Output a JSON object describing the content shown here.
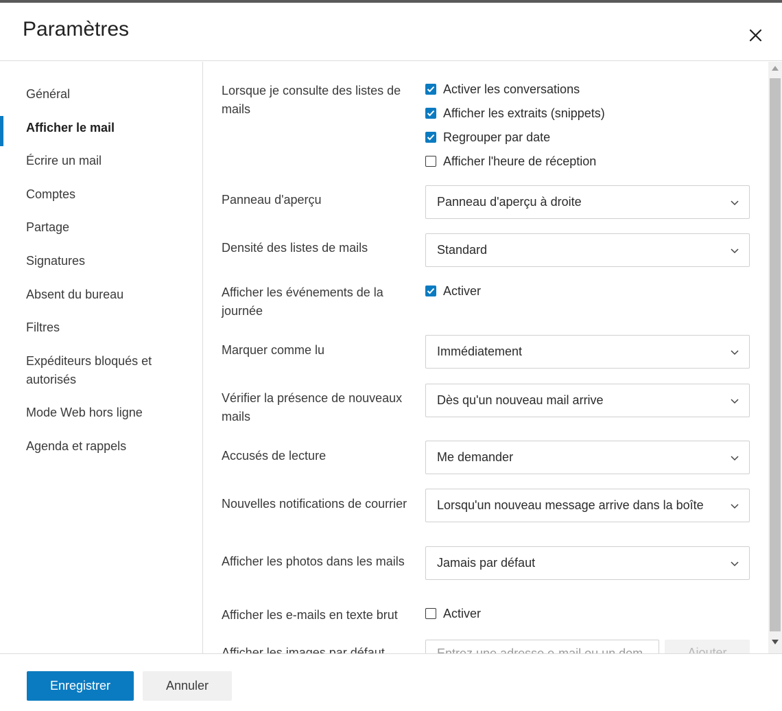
{
  "header": {
    "title": "Paramètres",
    "close_icon": "close-icon"
  },
  "sidebar": {
    "items": [
      {
        "label": "Général",
        "active": false
      },
      {
        "label": "Afficher le mail",
        "active": true
      },
      {
        "label": "Écrire un mail",
        "active": false
      },
      {
        "label": "Comptes",
        "active": false
      },
      {
        "label": "Partage",
        "active": false
      },
      {
        "label": "Signatures",
        "active": false
      },
      {
        "label": "Absent du bureau",
        "active": false
      },
      {
        "label": "Filtres",
        "active": false
      },
      {
        "label": "Expéditeurs bloqués et autorisés",
        "active": false
      },
      {
        "label": "Mode Web hors ligne",
        "active": false
      },
      {
        "label": "Agenda et rappels",
        "active": false
      }
    ]
  },
  "settings": {
    "mail_lists": {
      "label": "Lorsque je consulte des listes de mails",
      "options": [
        {
          "label": "Activer les conversations",
          "checked": true
        },
        {
          "label": "Afficher les extraits (snippets)",
          "checked": true
        },
        {
          "label": "Regrouper par date",
          "checked": true
        },
        {
          "label": "Afficher l'heure de réception",
          "checked": false
        }
      ]
    },
    "preview_pane": {
      "label": "Panneau d'aperçu",
      "value": "Panneau d'aperçu à droite"
    },
    "density": {
      "label": "Densité des listes de mails",
      "value": "Standard"
    },
    "day_events": {
      "label": "Afficher les événements de la journée",
      "option": "Activer",
      "checked": true
    },
    "mark_read": {
      "label": "Marquer comme lu",
      "value": "Immédiatement"
    },
    "check_new": {
      "label": "Vérifier la présence de nouveaux mails",
      "value": "Dès qu'un nouveau mail arrive"
    },
    "read_receipts": {
      "label": "Accusés de lecture",
      "value": "Me demander"
    },
    "notifications": {
      "label": "Nouvelles notifications de courrier",
      "value": "Lorsqu'un nouveau message arrive dans la boîte"
    },
    "photos": {
      "label": "Afficher les photos dans les mails",
      "value": "Jamais par défaut"
    },
    "plain_text": {
      "label": "Afficher les e-mails en texte brut",
      "option": "Activer",
      "checked": false
    },
    "default_images": {
      "label": "Afficher les images par défaut",
      "placeholder": "Entrez une adresse e-mail ou un dom",
      "add_label": "Ajouter"
    }
  },
  "footer": {
    "save_label": "Enregistrer",
    "cancel_label": "Annuler"
  },
  "colors": {
    "accent": "#0b7bc1",
    "border": "#dcdcdc",
    "text": "#3a3a3a"
  }
}
